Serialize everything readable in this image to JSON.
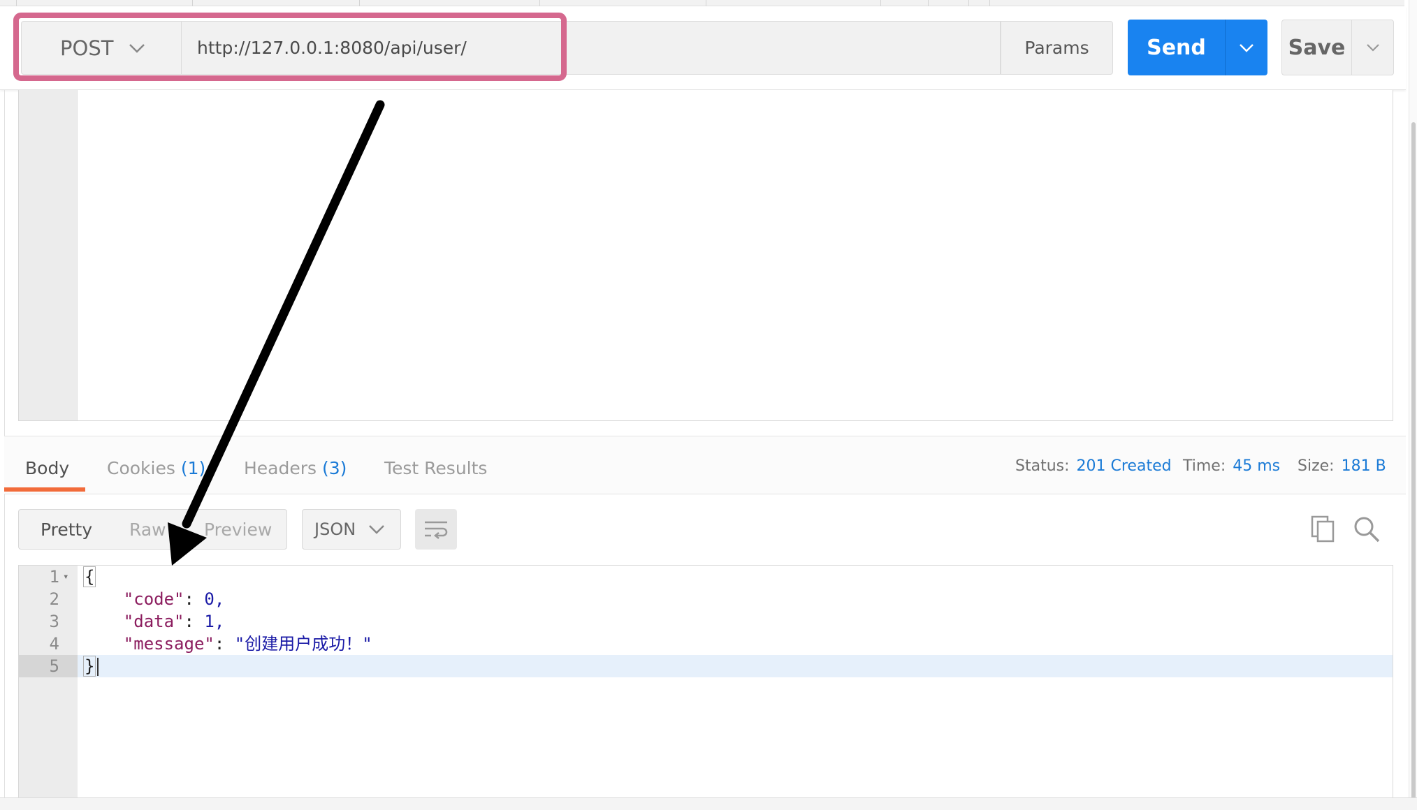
{
  "request": {
    "method": "POST",
    "url": "http://127.0.0.1:8080/api/user/",
    "params_label": "Params",
    "send_label": "Send",
    "save_label": "Save"
  },
  "response": {
    "tabs": [
      {
        "label": "Body",
        "count": ""
      },
      {
        "label": "Cookies",
        "count": "(1)"
      },
      {
        "label": "Headers",
        "count": "(3)"
      },
      {
        "label": "Test Results",
        "count": ""
      }
    ],
    "status_label": "Status:",
    "status_value": "201 Created",
    "time_label": "Time:",
    "time_value": "45 ms",
    "size_label": "Size:",
    "size_value": "181 B",
    "view_modes": [
      "Pretty",
      "Raw",
      "Preview"
    ],
    "format": "JSON",
    "lines": [
      {
        "num": "1",
        "text": "{"
      },
      {
        "num": "2",
        "key": "\"code\"",
        "value": "0,"
      },
      {
        "num": "3",
        "key": "\"data\"",
        "value": "1,"
      },
      {
        "num": "4",
        "key": "\"message\"",
        "value": "\"创建用户成功！\""
      },
      {
        "num": "5",
        "text": "}"
      }
    ]
  },
  "icons": {
    "method_dropdown": "chevron-down-icon",
    "send_dropdown": "chevron-down-icon",
    "save_dropdown": "chevron-down-icon",
    "format_dropdown": "chevron-down-icon",
    "wrap": "wrap-lines-icon",
    "copy": "copy-icon",
    "search": "search-icon"
  },
  "colors": {
    "send_button": "#1983f0",
    "annotation_border": "#d5688e",
    "active_tab_underline": "#f26b3a",
    "meta_value": "#1a7ad6"
  }
}
